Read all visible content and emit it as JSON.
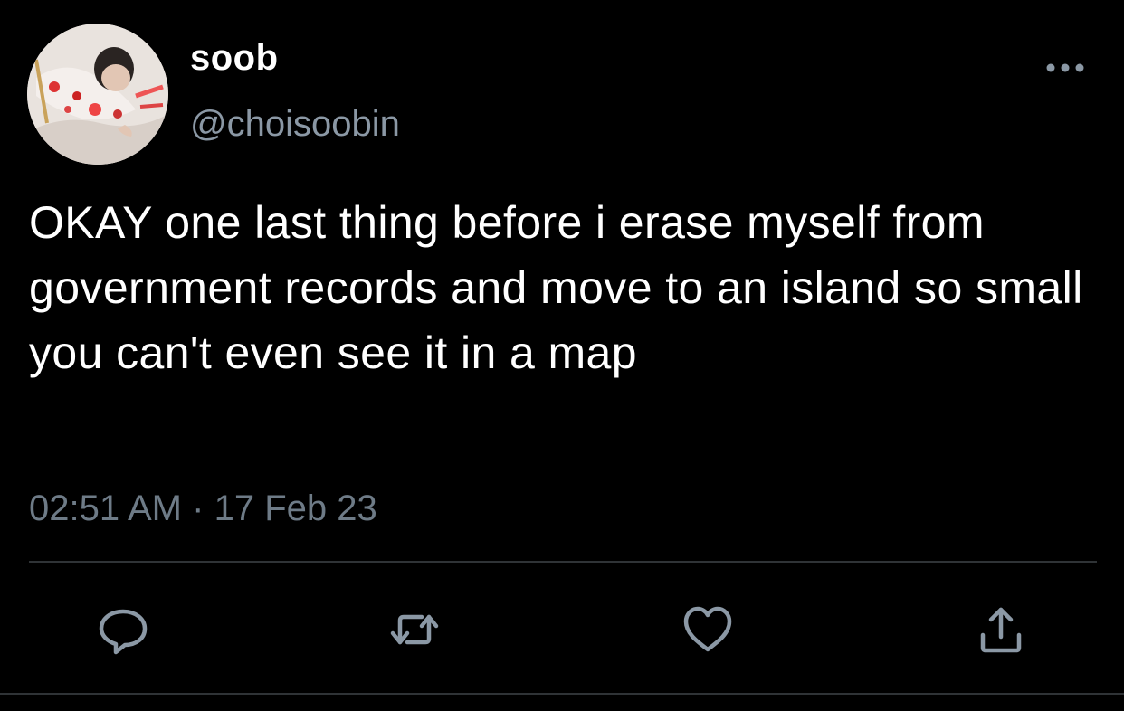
{
  "author": {
    "display_name": "soob",
    "handle": "@choisoobin"
  },
  "tweet": {
    "text": "OKAY one last thing before i erase myself from government records and move to an island so small you can't even see it in a map",
    "time": "02:51 AM",
    "separator": "·",
    "date": "17 Feb 23"
  },
  "icons": {
    "more": "more-horizontal-icon",
    "reply": "reply-bubble-icon",
    "retweet": "retweet-icon",
    "like": "heart-icon",
    "share": "share-upload-icon"
  },
  "colors": {
    "background": "#000000",
    "primary_text": "#ffffff",
    "secondary_text": "#8b98a5",
    "icon": "#8b98a5",
    "divider": "#2f3336"
  }
}
